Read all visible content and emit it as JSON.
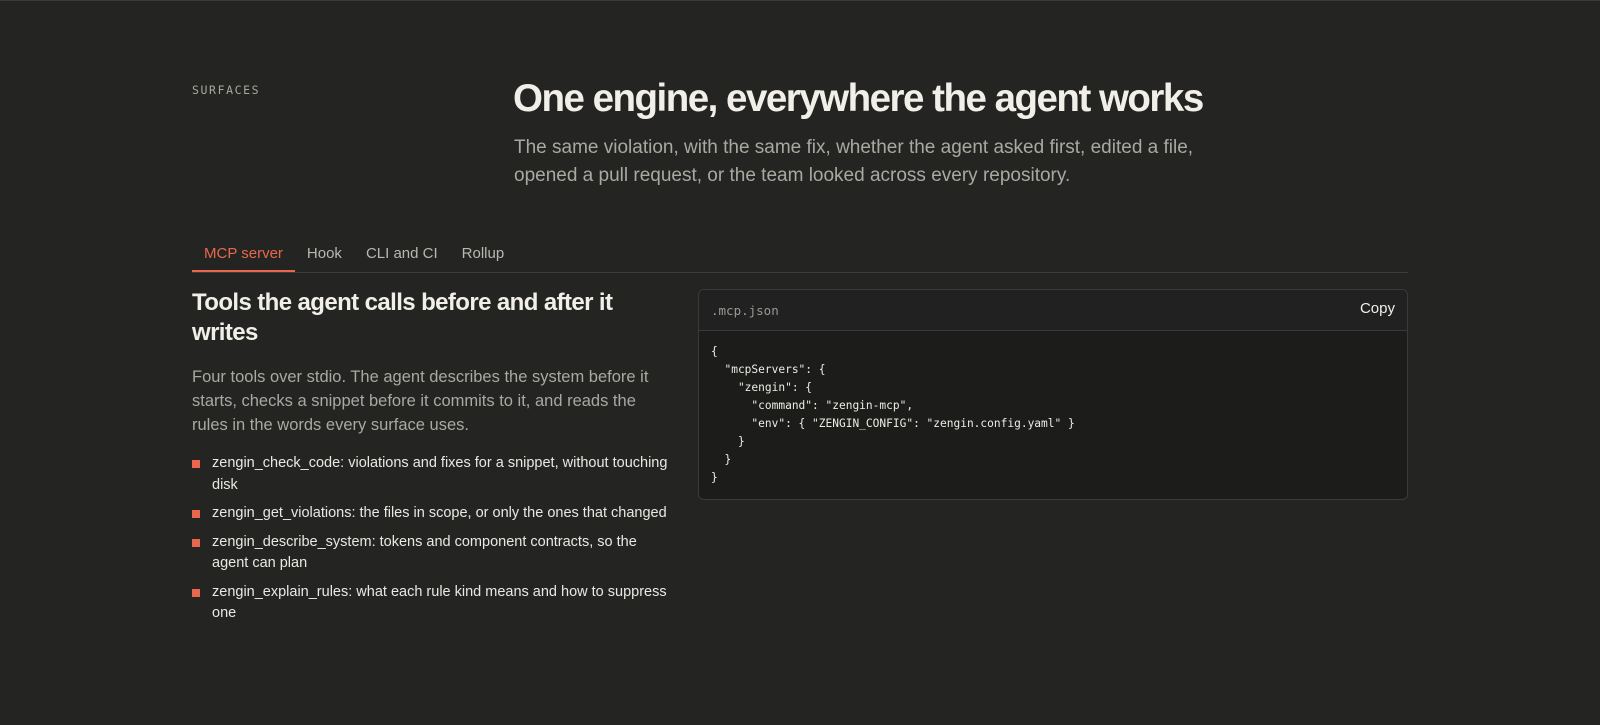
{
  "section": {
    "eyebrow": "SURFACES",
    "title": "One engine, everywhere the agent works",
    "description": "The same violation, with the same fix, whether the agent asked first, edited a file, opened a pull request, or the team looked across every repository."
  },
  "tabs": [
    {
      "label": "MCP server",
      "active": true
    },
    {
      "label": "Hook",
      "active": false
    },
    {
      "label": "CLI and CI",
      "active": false
    },
    {
      "label": "Rollup",
      "active": false
    }
  ],
  "panel": {
    "title": "Tools the agent calls before and after it writes",
    "description": "Four tools over stdio. The agent describes the system before it starts, checks a snippet before it commits to it, and reads the rules in the words every surface uses.",
    "tools": [
      "zengin_check_code: violations and fixes for a snippet, without touching disk",
      "zengin_get_violations: the files in scope, or only the ones that changed",
      "zengin_describe_system: tokens and component contracts, so the agent can plan",
      "zengin_explain_rules: what each rule kind means and how to suppress one"
    ]
  },
  "code_card": {
    "filename": ".mcp.json",
    "copy_label": "Copy",
    "code": "{\n  \"mcpServers\": {\n    \"zengin\": {\n      \"command\": \"zengin-mcp\",\n      \"env\": { \"ZENGIN_CONFIG\": \"zengin.config.yaml\" }\n    }\n  }\n}"
  },
  "colors": {
    "background": "#242523",
    "accent": "#e9674d",
    "code_background": "#1c1d1b"
  }
}
